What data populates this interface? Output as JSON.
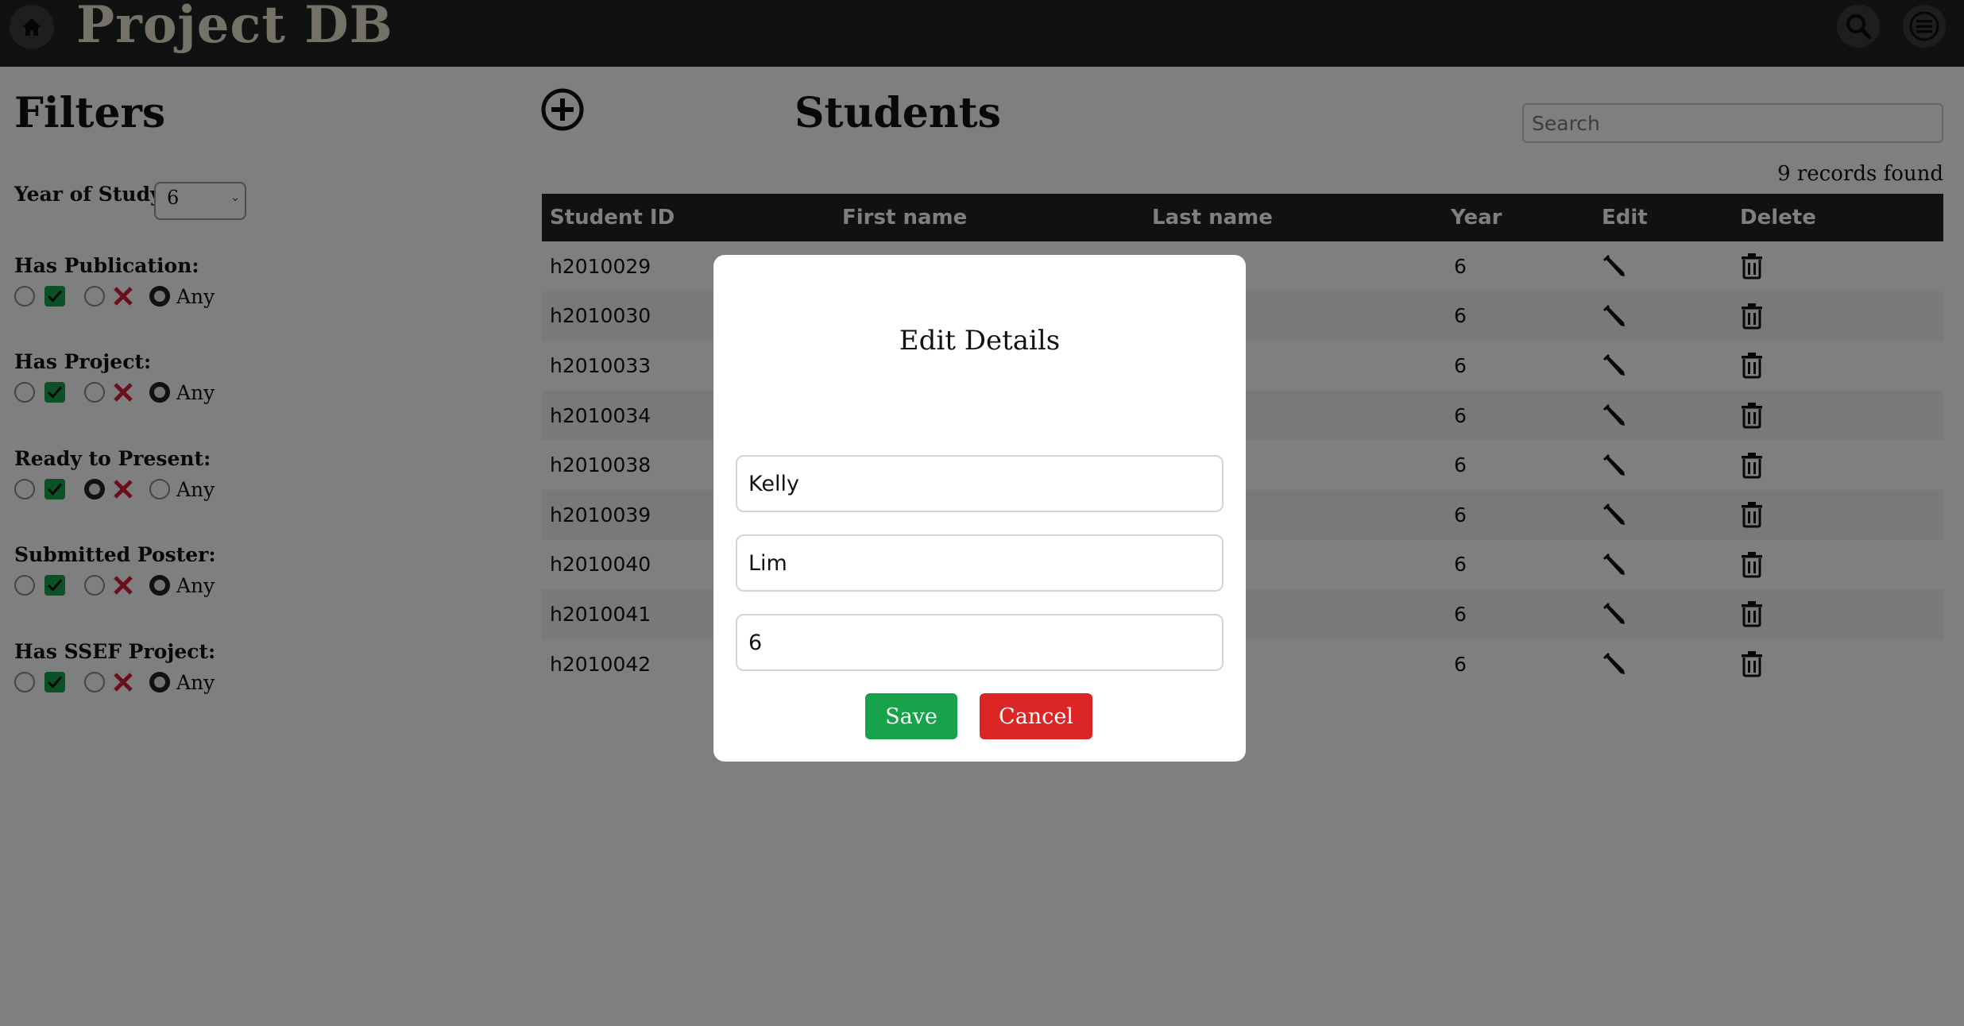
{
  "header": {
    "brand": "Project DB"
  },
  "filters": {
    "title": "Filters",
    "year_label": "Year of Study:",
    "year_value": "6",
    "groups": [
      {
        "label": "Has Publication:",
        "selected": "any",
        "any_label": "Any"
      },
      {
        "label": "Has Project:",
        "selected": "any",
        "any_label": "Any"
      },
      {
        "label": "Ready to Present:",
        "selected": "no",
        "any_label": "Any"
      },
      {
        "label": "Submitted Poster:",
        "selected": "any",
        "any_label": "Any"
      },
      {
        "label": "Has SSEF Project:",
        "selected": "any",
        "any_label": "Any"
      }
    ]
  },
  "main": {
    "title": "Students",
    "search_placeholder": "Search",
    "records_found": "9 records found",
    "columns": [
      "Student ID",
      "First name",
      "Last name",
      "Year",
      "Edit",
      "Delete"
    ],
    "rows": [
      {
        "id": "h2010029",
        "year": "6"
      },
      {
        "id": "h2010030",
        "year": "6"
      },
      {
        "id": "h2010033",
        "year": "6"
      },
      {
        "id": "h2010034",
        "year": "6"
      },
      {
        "id": "h2010038",
        "year": "6"
      },
      {
        "id": "h2010039",
        "year": "6"
      },
      {
        "id": "h2010040",
        "year": "6"
      },
      {
        "id": "h2010041",
        "year": "6"
      },
      {
        "id": "h2010042",
        "year": "6"
      }
    ]
  },
  "modal": {
    "title": "Edit Details",
    "first_name": "Kelly",
    "last_name": "Lim",
    "year": "6",
    "save_label": "Save",
    "cancel_label": "Cancel"
  },
  "colors": {
    "header_bg": "#202322",
    "brand_text": "#e9e2cc",
    "check_green": "#16a34a",
    "x_red": "#d61f3a",
    "save_green": "#16a34a",
    "cancel_red": "#dc2626"
  }
}
